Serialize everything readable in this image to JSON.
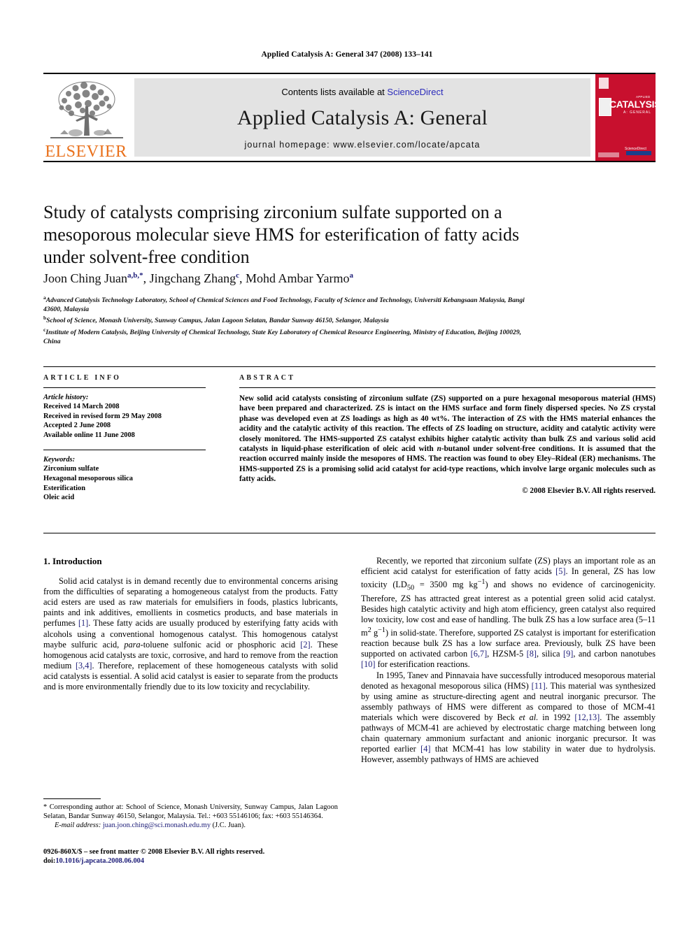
{
  "running_head": "Applied Catalysis A: General 347 (2008) 133–141",
  "masthead": {
    "elsevier_wordmark": "ELSEVIER",
    "contents_prefix": "Contents lists available at ",
    "contents_link": "ScienceDirect",
    "journal_name": "Applied Catalysis A: General",
    "homepage": "journal homepage: www.elsevier.com/locate/apcata",
    "cover": {
      "title": "CATALYSIS",
      "applied": "APPLIED",
      "subtitle": "A: GENERAL",
      "publisher": "ScienceDirect"
    },
    "accent_orange": "#E9711C",
    "banner_gray": "#e3e3e3",
    "cover_red": "#c8102e",
    "link_blue": "#2b2bbb"
  },
  "article": {
    "title": "Study of catalysts comprising zirconium sulfate supported on a mesoporous molecular sieve HMS for esterification of fatty acids under solvent-free condition",
    "authors": [
      {
        "name": "Joon Ching Juan",
        "marks": "a,b,*"
      },
      {
        "name": "Jingchang Zhang",
        "marks": "c"
      },
      {
        "name": "Mohd Ambar Yarmo",
        "marks": "a"
      }
    ],
    "affiliations": [
      {
        "mark": "a",
        "text": "Advanced Catalysis Technology Laboratory, School of Chemical Sciences and Food Technology, Faculty of Science and Technology, Universiti Kebangsaan Malaysia, Bangi 43600, Malaysia"
      },
      {
        "mark": "b",
        "text": "School of Science, Monash University, Sunway Campus, Jalan Lagoon Selatan, Bandar Sunway 46150, Selangor, Malaysia"
      },
      {
        "mark": "c",
        "text": "Institute of Modern Catalysis, Beijing University of Chemical Technology, State Key Laboratory of Chemical Resource Engineering, Ministry of Education, Beijing 100029, China"
      }
    ]
  },
  "article_info": {
    "heading": "ARTICLE INFO",
    "history_label": "Article history:",
    "history": [
      "Received 14 March 2008",
      "Received in revised form 29 May 2008",
      "Accepted 2 June 2008",
      "Available online 11 June 2008"
    ],
    "keywords_label": "Keywords:",
    "keywords": [
      "Zirconium sulfate",
      "Hexagonal mesoporous silica",
      "Esterification",
      "Oleic acid"
    ]
  },
  "abstract": {
    "heading": "ABSTRACT",
    "text": "New solid acid catalysts consisting of zirconium sulfate (ZS) supported on a pure hexagonal mesoporous material (HMS) have been prepared and characterized. ZS is intact on the HMS surface and form finely dispersed species. No ZS crystal phase was developed even at ZS loadings as high as 40 wt%. The interaction of ZS with the HMS material enhances the acidity and the catalytic activity of this reaction. The effects of ZS loading on structure, acidity and catalytic activity were closely monitored. The HMS-supported ZS catalyst exhibits higher catalytic activity than bulk ZS and various solid acid catalysts in liquid-phase esterification of oleic acid with n-butanol under solvent-free conditions. It is assumed that the reaction occurred mainly inside the mesopores of HMS. The reaction was found to obey Eley–Rideal (ER) mechanisms. The HMS-supported ZS is a promising solid acid catalyst for acid-type reactions, which involve large organic molecules such as fatty acids.",
    "copyright": "© 2008 Elsevier B.V. All rights reserved."
  },
  "introduction": {
    "heading": "1. Introduction",
    "left_paragraph": "Solid acid catalyst is in demand recently due to environmental concerns arising from the difficulties of separating a homogeneous catalyst from the products. Fatty acid esters are used as raw materials for emulsifiers in foods, plastics lubricants, paints and ink additives, emollients in cosmetics products, and base materials in perfumes [1]. These fatty acids are usually produced by esterifying fatty acids with alcohols using a conventional homogenous catalyst. This homogenous catalyst maybe sulfuric acid, para-toluene sulfonic acid or phosphoric acid [2]. These homogenous acid catalysts are toxic, corrosive, and hard to remove from the reaction medium [3,4]. Therefore, replacement of these homogeneous catalysts with solid acid catalysts is essential. A solid acid catalyst is easier to separate from the products and is more environmentally friendly due to its low toxicity and recyclability.",
    "right_paragraph_1": "Recently, we reported that zirconium sulfate (ZS) plays an important role as an efficient acid catalyst for esterification of fatty acids [5]. In general, ZS has low toxicity (LD50 = 3500 mg kg−1) and shows no evidence of carcinogenicity. Therefore, ZS has attracted great interest as a potential green solid acid catalyst. Besides high catalytic activity and high atom efficiency, green catalyst also required low toxicity, low cost and ease of handling. The bulk ZS has a low surface area (5–11 m2 g−1) in solid-state. Therefore, supported ZS catalyst is important for esterification reaction because bulk ZS has a low surface area. Previously, bulk ZS have been supported on activated carbon [6,7], HZSM-5 [8], silica [9], and carbon nanotubes [10] for esterification reactions.",
    "right_paragraph_2": "In 1995, Tanev and Pinnavaia have successfully introduced mesoporous material denoted as hexagonal mesoporous silica (HMS) [11]. This material was synthesized by using amine as structure-directing agent and neutral inorganic precursor. The assembly pathways of HMS were different as compared to those of MCM-41 materials which were discovered by Beck et al. in 1992 [12,13]. The assembly pathways of MCM-41 are achieved by electrostatic charge matching between long chain quaternary ammonium surfactant and anionic inorganic precursor. It was reported earlier [4] that MCM-41 has low stability in water due to hydrolysis. However, assembly pathways of HMS are achieved"
  },
  "footnote": {
    "corresponding": "* Corresponding author at: School of Science, Monash University, Sunway Campus, Jalan Lagoon Selatan, Bandar Sunway 46150, Selangor, Malaysia. Tel.: +603 55146106; fax: +603 55146364.",
    "email_label": "E-mail address:",
    "email": "juan.joon.ching@sci.monash.edu.my",
    "email_owner": "(J.C. Juan)."
  },
  "imprint": {
    "line1": "0926-860X/$ – see front matter © 2008 Elsevier B.V. All rights reserved.",
    "doi_label": "doi:",
    "doi": "10.1016/j.apcata.2008.06.004"
  }
}
